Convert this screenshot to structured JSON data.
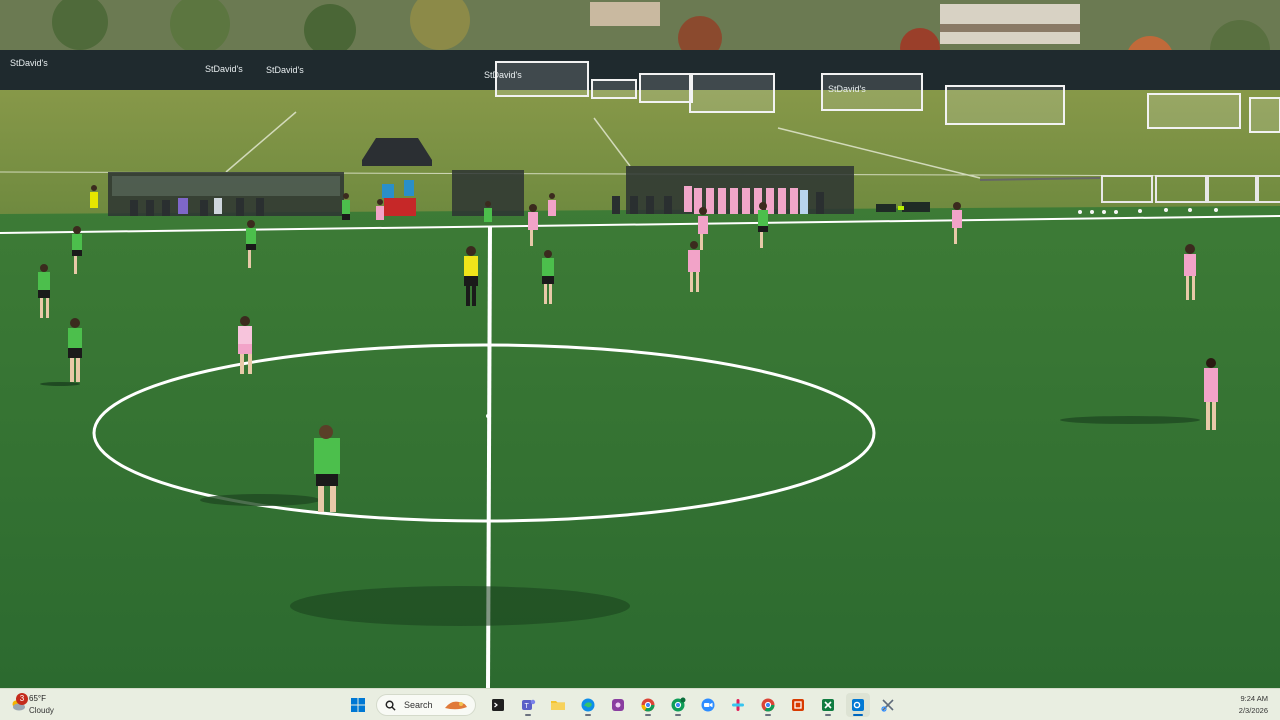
{
  "video": {
    "sponsor_banner": "StDavid's",
    "colors": {
      "pitch": "#2f6a2f",
      "pitch_far": "#6f8a3f",
      "home_kit": "#4cbf4c",
      "away_kit": "#f2a3c8",
      "referee": "#f0e51a"
    }
  },
  "taskbar": {
    "weather": {
      "temp": "65°F",
      "condition": "Cloudy",
      "badge": "3",
      "icon": "cloud-sun-icon"
    },
    "search_label": "Search",
    "apps": [
      {
        "name": "windows-start-icon",
        "color": "#0078d4"
      },
      {
        "name": "search-icon",
        "color": "#222222"
      },
      {
        "name": "terminal-icon",
        "color": "#1f1f1f"
      },
      {
        "name": "teams-icon",
        "color": "#5b5fc7"
      },
      {
        "name": "file-explorer-icon",
        "color": "#f4c430"
      },
      {
        "name": "edge-icon",
        "color": "#0e8ee9"
      },
      {
        "name": "app-icon",
        "color": "#8a3ea0"
      },
      {
        "name": "chrome-icon",
        "color": "#db4437"
      },
      {
        "name": "chrome-profile-icon",
        "color": "#0f9d58"
      },
      {
        "name": "zoom-icon",
        "color": "#2d8cff"
      },
      {
        "name": "slack-icon",
        "color": "#e01e5a"
      },
      {
        "name": "chrome-alt-icon",
        "color": "#4285f4"
      },
      {
        "name": "office-icon",
        "color": "#d83b01"
      },
      {
        "name": "excel-icon",
        "color": "#107c41"
      },
      {
        "name": "outlook-icon",
        "color": "#0078d4"
      },
      {
        "name": "snipping-tool-icon",
        "color": "#5f6b7a"
      }
    ],
    "clock": {
      "time": "9:24 AM",
      "date": "2/3/2026"
    }
  }
}
